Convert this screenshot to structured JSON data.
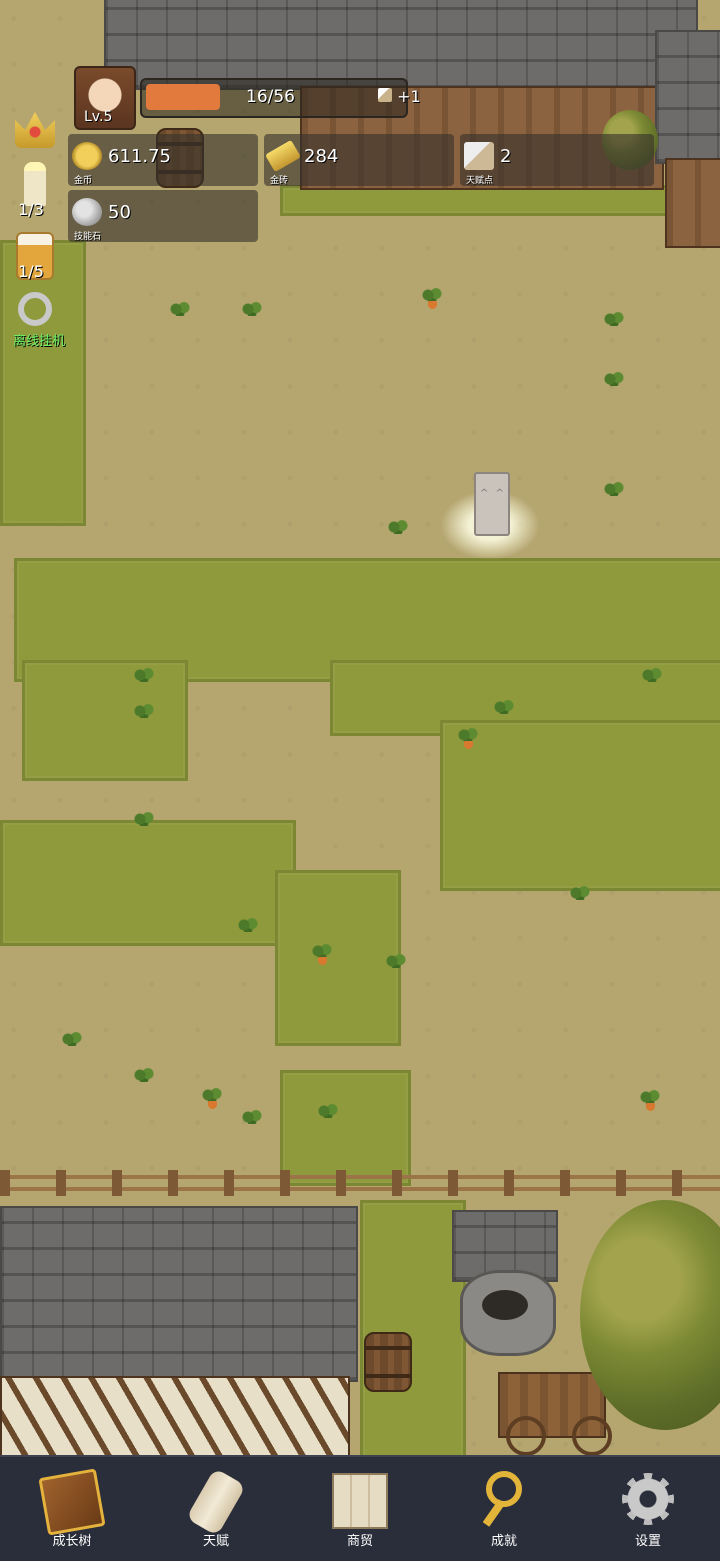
{
  "player": {
    "level": "Lv.5",
    "xp_text": "16/56",
    "xp_fraction": 0.29,
    "xp_bonus": "+1"
  },
  "resources": {
    "gold": {
      "value": "611.75",
      "caption": "金币",
      "icon": "gold-coin-icon"
    },
    "gold_brick": {
      "value": "284",
      "caption": "金砖",
      "icon": "gold-brick-icon"
    },
    "talent_points": {
      "value": "2",
      "caption": "天赋点",
      "icon": "scroll-quill-icon"
    },
    "skill_stone": {
      "value": "50",
      "caption": "技能石",
      "icon": "stone-icon"
    }
  },
  "side_items": {
    "crown": {
      "icon": "crown-icon"
    },
    "candle": {
      "count": "1/3",
      "icon": "candle-icon"
    },
    "beer": {
      "count": "1/5",
      "icon": "beer-mug-icon"
    },
    "idle": {
      "label": "离线挂机",
      "icon": "key-icon"
    }
  },
  "nav": [
    {
      "label": "成长树",
      "icon": "book-icon"
    },
    {
      "label": "天赋",
      "icon": "scroll-icon"
    },
    {
      "label": "商贸",
      "icon": "map-icon"
    },
    {
      "label": "成就",
      "icon": "golden-key-icon"
    },
    {
      "label": "设置",
      "icon": "gear-icon"
    }
  ],
  "colors": {
    "xp_fill": "#e27a3d",
    "nav_bg": "#2a2d3a",
    "idle_label": "#6cf266"
  }
}
